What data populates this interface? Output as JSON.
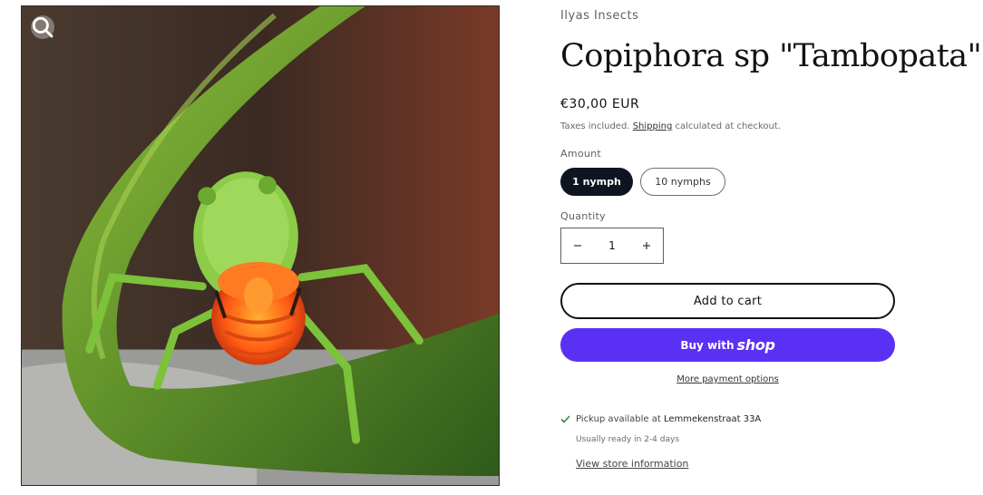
{
  "product": {
    "vendor": "Ilyas Insects",
    "title": "Copiphora sp \"Tambopata\"",
    "price": "€30,00 EUR",
    "tax_prefix": "Taxes included.",
    "tax_link": "Shipping",
    "tax_suffix": "calculated at checkout."
  },
  "gallery": {
    "zoom_icon": "magnifier-icon"
  },
  "variants": {
    "label": "Amount",
    "options": [
      "1 nymph",
      "10 nymphs"
    ],
    "selected": "1 nymph"
  },
  "quantity": {
    "label": "Quantity",
    "value": "1",
    "decrease_icon": "minus-icon",
    "increase_icon": "plus-icon"
  },
  "buttons": {
    "add_to_cart": "Add to cart",
    "buy_with": "Buy with",
    "shop_word": "shop",
    "more_payment": "More payment options"
  },
  "pickup": {
    "icon": "checkmark-icon",
    "prefix": "Pickup available at",
    "location": "Lemmekenstraat 33A",
    "ready": "Usually ready in 2-4 days",
    "store_link": "View store information"
  },
  "colors": {
    "shop_button": "#5a31f4",
    "selected_pill": "#0d1521",
    "check": "#2e8b3e"
  }
}
